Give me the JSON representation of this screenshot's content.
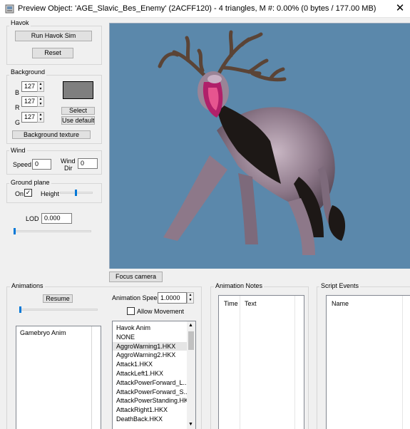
{
  "window": {
    "title": "Preview Object: 'AGE_Slavic_Bes_Enemy' (2ACFF120) - 4 triangles, M #: 0.00% (0 bytes / 177.00 MB)",
    "close_glyph": "✕"
  },
  "havok": {
    "label": "Havok",
    "run_label": "Run Havok Sim",
    "reset_label": "Reset"
  },
  "background": {
    "label": "Background",
    "b_label": "B",
    "b_value": "127",
    "r_label": "R",
    "r_value": "127",
    "g_label": "G",
    "g_value": "127",
    "swatch_color": "#7f7f7f",
    "select_label": "Select",
    "use_default_label": "Use default",
    "texture_label": "Background texture"
  },
  "wind": {
    "label": "Wind",
    "speed_label": "Speed",
    "speed_value": "0",
    "dir_label_1": "Wind",
    "dir_label_2": "Dir",
    "dir_value": "0"
  },
  "ground": {
    "label": "Ground plane",
    "on_label": "On",
    "on_checked": true,
    "height_label": "Height"
  },
  "lod": {
    "label": "LOD",
    "value": "0.000"
  },
  "viewport": {
    "background": "#5b88ab",
    "focus_label": "Focus camera"
  },
  "animations": {
    "label": "Animations",
    "resume_label": "Resume",
    "speed_label": "Animation Speed",
    "speed_value": "1.0000",
    "allow_movement_label": "Allow Movement",
    "gamebryo_header": "Gamebryo Anim",
    "havok_header": "Havok Anim",
    "havok_items": [
      "NONE",
      "AggroWarning1.HKX",
      "AggroWarning2.HKX",
      "Attack1.HKX",
      "AttackLeft1.HKX",
      "AttackPowerForward_L...",
      "AttackPowerForward_S...",
      "AttackPowerStanding.HKX",
      "AttackRight1.HKX",
      "DeathBack.HKX"
    ],
    "selected_index": 1
  },
  "notes": {
    "label": "Animation Notes",
    "col_time": "Time",
    "col_text": "Text"
  },
  "script": {
    "label": "Script Events",
    "col_name": "Name"
  }
}
